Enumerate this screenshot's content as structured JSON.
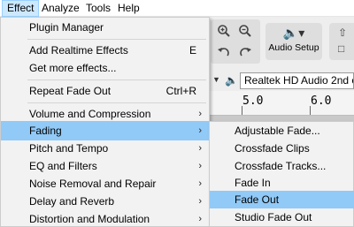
{
  "menubar": {
    "items": [
      {
        "label": "Effect"
      },
      {
        "label": "Analyze"
      },
      {
        "label": "Tools"
      },
      {
        "label": "Help"
      }
    ]
  },
  "toolbar": {
    "audio_setup_label": "Audio Setup",
    "audio_setup_icon": "speaker-dropdown-icon",
    "tool_icons": [
      "zoom-in-icon",
      "zoom-out-icon",
      "undo-icon",
      "redo-icon"
    ]
  },
  "device": {
    "playback_device": "Realtek HD Audio 2nd out"
  },
  "ruler": {
    "labels": [
      "5.0",
      "6.0"
    ]
  },
  "effect_menu": {
    "items": [
      {
        "label": "Plugin Manager"
      },
      {
        "label": "Add Realtime Effects",
        "shortcut": "E"
      },
      {
        "label": "Get more effects..."
      },
      {
        "label": "Repeat Fade Out",
        "shortcut": "Ctrl+R"
      },
      {
        "label": "Volume and Compression"
      },
      {
        "label": "Fading"
      },
      {
        "label": "Pitch and Tempo"
      },
      {
        "label": "EQ and Filters"
      },
      {
        "label": "Noise Removal and Repair"
      },
      {
        "label": "Delay and Reverb"
      },
      {
        "label": "Distortion and Modulation"
      }
    ]
  },
  "fading_submenu": {
    "items": [
      {
        "label": "Adjustable Fade..."
      },
      {
        "label": "Crossfade Clips"
      },
      {
        "label": "Crossfade Tracks..."
      },
      {
        "label": "Fade In"
      },
      {
        "label": "Fade Out"
      },
      {
        "label": "Studio Fade Out"
      }
    ]
  },
  "colors": {
    "highlight": "#91c9f7",
    "menubar_active": "#cce8ff",
    "menu_bg": "#f2f2f2"
  }
}
